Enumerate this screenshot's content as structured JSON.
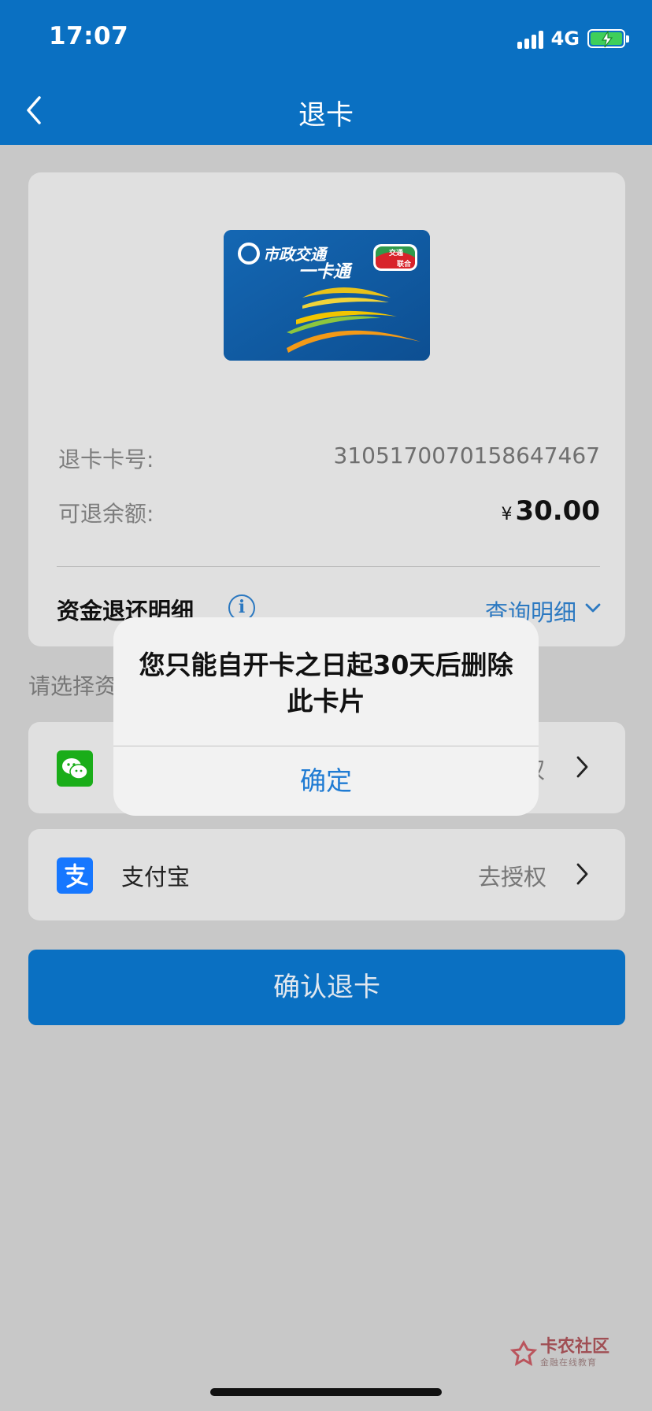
{
  "status_bar": {
    "time": "17:07",
    "network": "4G"
  },
  "header": {
    "title": "退卡"
  },
  "card": {
    "number_label": "退卡卡号:",
    "number_value": "3105170070158647467",
    "balance_label": "可退余额:",
    "balance_currency": "¥",
    "balance_value": "30.00",
    "funds_label": "资金退还明细",
    "query_link": "查询明细",
    "image_text": {
      "brand": "市政交通",
      "name": "一卡通",
      "badge_top": "交通",
      "badge_bottom": "联合"
    }
  },
  "choose_label": "请选择资",
  "payment_options": [
    {
      "name": "",
      "action": "权",
      "icon": "wechat-icon"
    },
    {
      "name": "支付宝",
      "action": "去授权",
      "icon": "alipay-icon"
    }
  ],
  "confirm_button": "确认退卡",
  "alert": {
    "message": "您只能自开卡之日起30天后删除此卡片",
    "button": "确定"
  },
  "watermark": {
    "title": "卡农社区",
    "subtitle": "金融在线教育"
  },
  "colors": {
    "primary": "#0a70c2",
    "link": "#1f7bd3",
    "wechat": "#1aad19",
    "alipay": "#1677ff"
  }
}
